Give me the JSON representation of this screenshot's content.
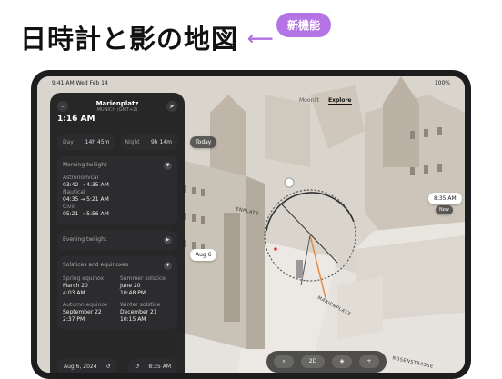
{
  "headline": "日時計と影の地図",
  "badge": "新機能",
  "status": {
    "time": "9:41 AM",
    "date": "Wed Feb 14",
    "battery": "100%"
  },
  "panel": {
    "place": "Marienplatz",
    "tz": "MUNICH (GMT+2)",
    "time": "1:16 AM",
    "day_label": "Day",
    "day_value": "14h 45m",
    "night_label": "Night",
    "night_value": "9h 14m",
    "morning_title": "Morning twilight",
    "astro_label": "Astronomical",
    "astro_value": "03:42 → 4:35 AM",
    "naut_label": "Nautical",
    "naut_value": "04:35 → 5:21 AM",
    "civil_label": "Civil",
    "civil_value": "05:21 → 5:56 AM",
    "evening_title": "Evening twilight",
    "solstice_title": "Solstices and equinoxes",
    "spring_label": "Spring equinox",
    "spring_date": "March 20",
    "spring_time": "4:03 AM",
    "summer_label": "Summer solstice",
    "summer_date": "June 20",
    "summer_time": "10:48 PM",
    "autumn_label": "Autumn equinox",
    "autumn_date": "September 22",
    "autumn_time": "2:37 PM",
    "winter_label": "Winter solstice",
    "winter_date": "December 21",
    "winter_time": "10:15 AM",
    "bottom_date": "Aug 6, 2024",
    "bottom_time": "8:35 AM"
  },
  "map": {
    "seg_a": "Moonlit",
    "seg_b": "Explore",
    "today": "Today",
    "time_chip": "8:35 AM",
    "now": "Now",
    "date_chip": "Aug 6",
    "street1": "ENPLATZ",
    "street2": "MARIENPLATZ",
    "street3": "ROSENSTRASSE",
    "mode": "2D"
  }
}
